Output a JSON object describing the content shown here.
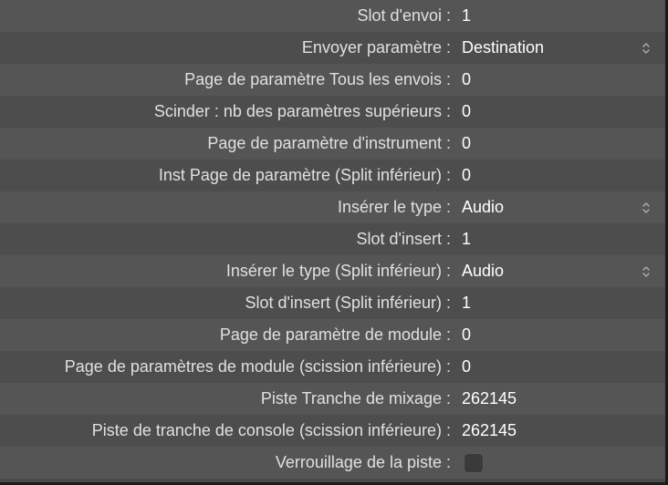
{
  "rows": [
    {
      "label": "Slot d'envoi :",
      "value": "1",
      "type": "text"
    },
    {
      "label": "Envoyer paramètre :",
      "value": "Destination",
      "type": "dropdown"
    },
    {
      "label": "Page de paramètre Tous les envois :",
      "value": "0",
      "type": "text"
    },
    {
      "label": "Scinder : nb des paramètres supérieurs :",
      "value": "0",
      "type": "text"
    },
    {
      "label": "Page de paramètre d'instrument :",
      "value": "0",
      "type": "text"
    },
    {
      "label": "Inst Page de paramètre (Split inférieur) :",
      "value": "0",
      "type": "text"
    },
    {
      "label": "Insérer le type :",
      "value": "Audio",
      "type": "dropdown"
    },
    {
      "label": "Slot d'insert :",
      "value": "1",
      "type": "text"
    },
    {
      "label": "Insérer le type (Split inférieur) :",
      "value": "Audio",
      "type": "dropdown"
    },
    {
      "label": "Slot d'insert (Split inférieur) :",
      "value": "1",
      "type": "text"
    },
    {
      "label": "Page de paramètre de module :",
      "value": "0",
      "type": "text"
    },
    {
      "label": "Page de paramètres de module (scission inférieure) :",
      "value": "0",
      "type": "text"
    },
    {
      "label": "Piste Tranche de mixage :",
      "value": "262145",
      "type": "text"
    },
    {
      "label": "Piste de tranche de console (scission inférieure) :",
      "value": "262145",
      "type": "text"
    },
    {
      "label": "Verrouillage de la piste :",
      "value": "",
      "type": "checkbox"
    }
  ]
}
